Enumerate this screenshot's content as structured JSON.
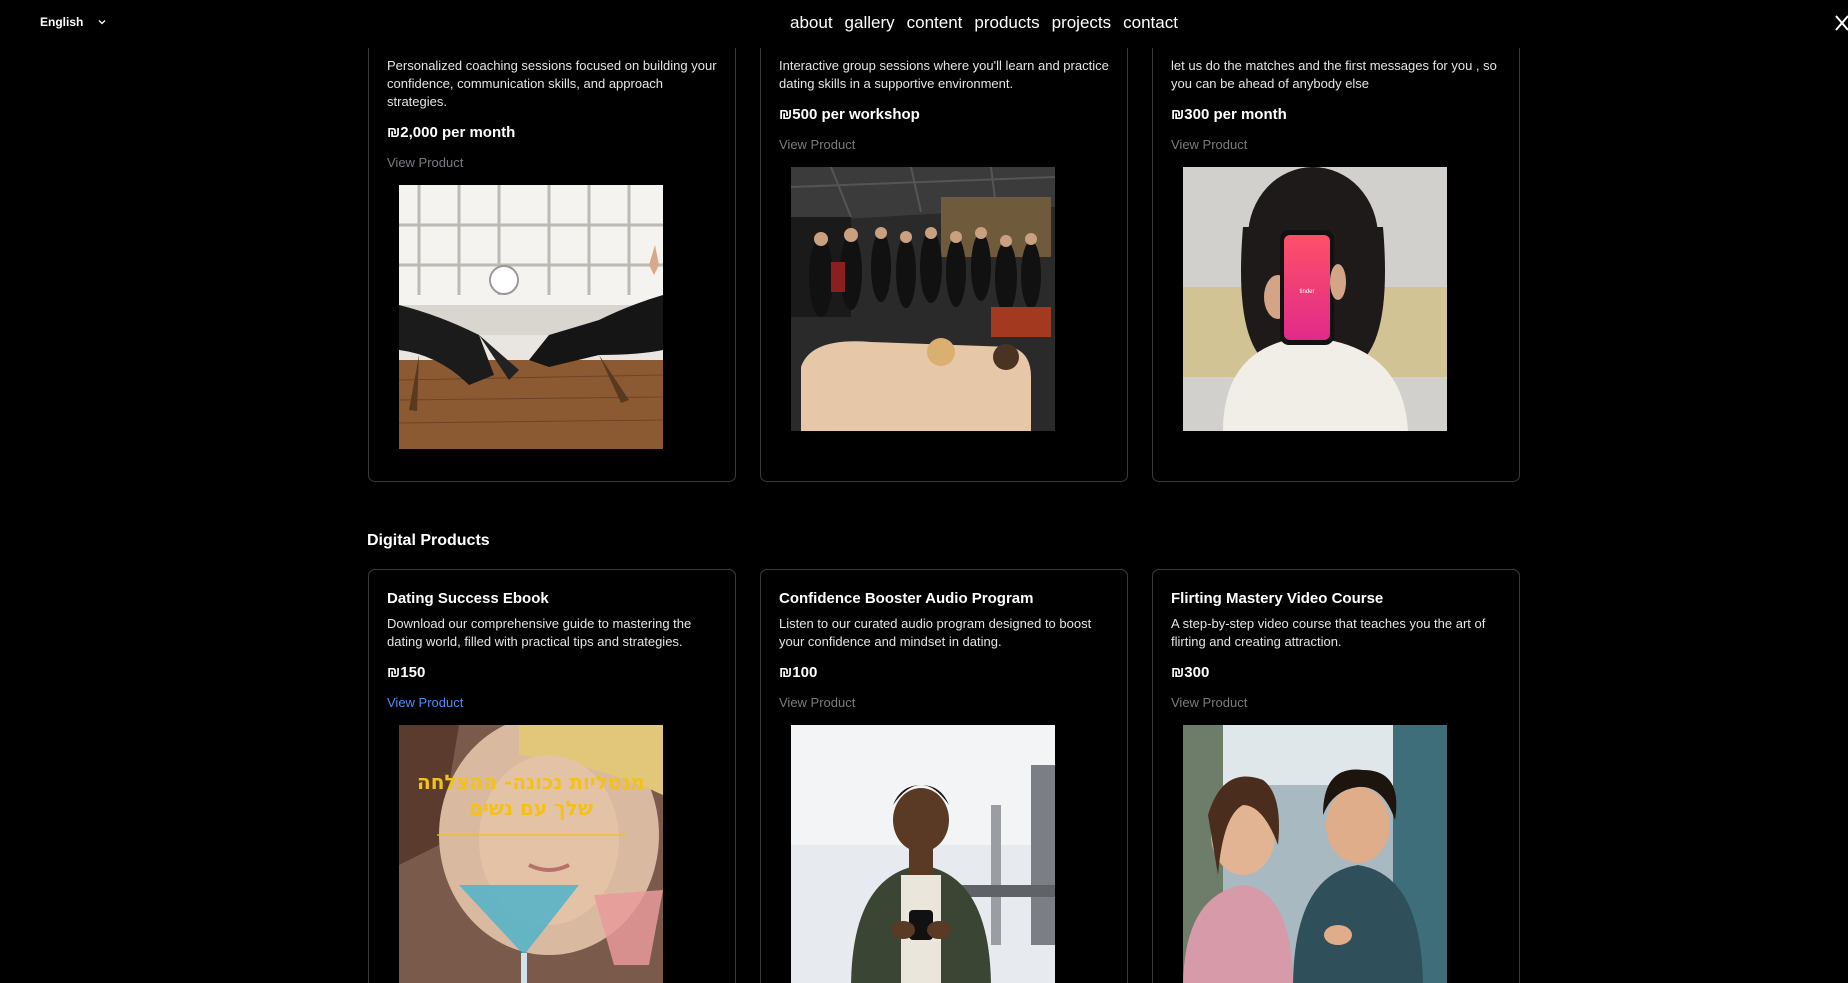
{
  "header": {
    "language": "English",
    "nav": [
      "about",
      "gallery",
      "content",
      "products",
      "projects",
      "contact"
    ]
  },
  "top_products": [
    {
      "description": "Personalized coaching sessions focused on building your confidence, communication skills, and approach strategies.",
      "price": "₪2,000 per month",
      "link": "View Product",
      "image_icon": "therapy-session-photo"
    },
    {
      "description": "Interactive group sessions where you'll learn and practice dating skills in a supportive environment.",
      "price": "₪500 per workshop",
      "link": "View Product",
      "image_icon": "group-workshop-photo"
    },
    {
      "description": "let us do the matches and the first messages for you , so you can be ahead of anybody else",
      "price": "₪300 per month",
      "link": "View Product",
      "image_icon": "tinder-phone-photo"
    }
  ],
  "digital_section": {
    "title": "Digital Products",
    "products": [
      {
        "title": "Dating Success Ebook",
        "description": "Download our comprehensive guide to mastering the dating world, filled with practical tips and strategies.",
        "price": "₪150",
        "link": "View Product",
        "image_text_line1": "מנטליות נכונה- ההצלחה",
        "image_text_line2": "שלך עם נשים"
      },
      {
        "title": "Confidence Booster Audio Program",
        "description": "Listen to our curated audio program designed to boost your confidence and mindset in dating.",
        "price": "₪100",
        "link": "View Product"
      },
      {
        "title": "Flirting Mastery Video Course",
        "description": "A step-by-step video course that teaches you the art of flirting and creating attraction.",
        "price": "₪300",
        "link": "View Product"
      }
    ]
  },
  "tinder_label": "tinder",
  "colors": {
    "link_active": "#4d8df7",
    "link": "#7a7a80",
    "border": "#3b3b3f",
    "ebook_gold": "#f2c21b"
  }
}
